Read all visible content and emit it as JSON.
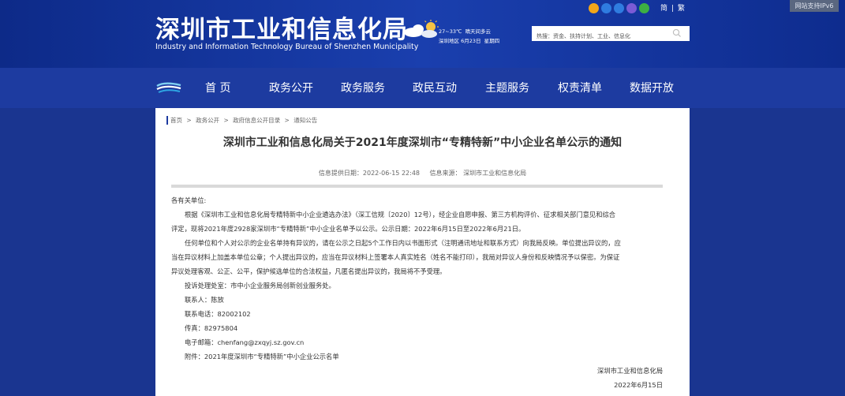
{
  "header": {
    "title_cn": "深圳市工业和信息化局",
    "title_en": "Industry and Information Technology Bureau of Shenzhen Municipality",
    "weather": {
      "temp": "27~33℃",
      "desc": "晴天间多云",
      "location": "深圳地区",
      "date": "6月23日",
      "weekday": "星期四"
    },
    "search": {
      "placeholder": "热搜：资金、扶持计划、工业、信息化"
    },
    "lang": {
      "simplified": "简",
      "separator": "|",
      "traditional": "繁"
    },
    "ipv6": "网站支持IPv6",
    "top_icons": [
      {
        "name": "accessibility-icon",
        "color": "#f2a619"
      },
      {
        "name": "weibo-icon",
        "color": "#2f7ce0"
      },
      {
        "name": "mail-icon",
        "color": "#2f7ce0"
      },
      {
        "name": "mobile-icon",
        "color": "#7b5bd6"
      },
      {
        "name": "wechat-icon",
        "color": "#3db043"
      }
    ]
  },
  "nav": {
    "items": [
      "首 页",
      "政务公开",
      "政务服务",
      "政民互动",
      "主题服务",
      "权责清单",
      "数据开放"
    ]
  },
  "breadcrumb": [
    "首页",
    ">",
    "政务公开",
    ">",
    "政府信息公开目录",
    ">",
    "通知公告"
  ],
  "article": {
    "title": "深圳市工业和信息化局关于2021年度深圳市“专精特新”中小企业名单公示的通知",
    "meta_date": "信息提供日期：2022-06-15 22:48",
    "meta_source": "信息来源：  深圳市工业和信息化局",
    "salutation": "各有关单位:",
    "para1_line1": "根据《深圳市工业和信息化局专精特新中小企业遴选办法》（深工信规〔2020〕12号），经企业自愿申报、第三方机构评价、征求相关部门意见和综合",
    "para1_line2": "评定，现将2021年度2928家深圳市“专精特新”中小企业名单予以公示。公示日期：2022年6月15日至2022年6月21日。",
    "para2_line1": "任何单位和个人对公示的企业名单持有异议的，请在公示之日起5个工作日内以书面形式（注明通讯地址和联系方式）向我局反映。单位提出异议的，应",
    "para2_line2": "当在异议材料上加盖本单位公章；个人提出异议的，应当在异议材料上签署本人真实姓名（姓名不能打印），我局对异议人身份和反映情况予以保密。为保证",
    "para2_line3": "异议处理客观、公正、公平，保护候选单位的合法权益，凡匿名提出异议的，我局将不予受理。",
    "office": "投诉处理处室：市中小企业服务局创新创业服务处。",
    "contact": "联系人：陈放",
    "phone": "联系电话：82002102",
    "fax": "传真：82975804",
    "email": "电子邮箱：chenfang@zxqyj.sz.gov.cn",
    "attachment": "附件：2021年度深圳市“专精特新”中小企业公示名单",
    "signer": "深圳市工业和信息化局",
    "sign_date": "2022年6月15日"
  }
}
